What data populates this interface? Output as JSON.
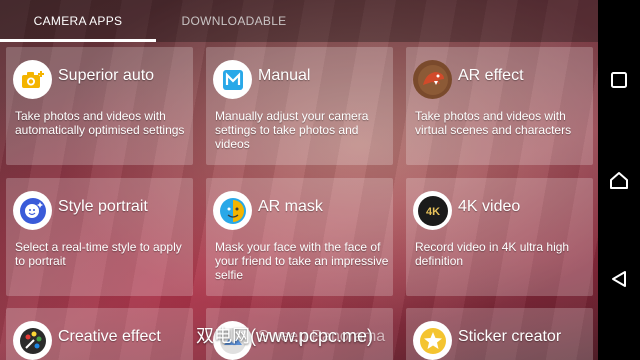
{
  "tabs": [
    {
      "label": "CAMERA APPS",
      "active": true
    },
    {
      "label": "DOWNLOADABLE",
      "active": false
    }
  ],
  "apps": [
    {
      "title": "Superior auto",
      "desc": "Take photos and videos with automatically optimised settings",
      "icon": "camera-plus-icon"
    },
    {
      "title": "Manual",
      "desc": "Manually adjust your camera settings to take photos and videos",
      "icon": "manual-m-icon"
    },
    {
      "title": "AR effect",
      "desc": "Take photos and videos with virtual scenes and characters",
      "icon": "dinosaur-icon"
    },
    {
      "title": "Style portrait",
      "desc": "Select a real-time style to apply to portrait",
      "icon": "face-sparkle-icon"
    },
    {
      "title": "AR mask",
      "desc": "Mask your face with the face of your friend to take an impressive selfie",
      "icon": "mask-face-icon"
    },
    {
      "title": "4K video",
      "desc": "Record video in 4K ultra high definition",
      "icon": "4k-badge-icon"
    },
    {
      "title": "Creative effect",
      "desc": "",
      "icon": "palette-icon"
    },
    {
      "title": "Sweep Panorama",
      "desc": "",
      "icon": "panorama-icon"
    },
    {
      "title": "Sticker creator",
      "desc": "",
      "icon": "star-sticker-icon"
    }
  ],
  "watermark": "双电网(www.pcpc.me)",
  "colors": {
    "accent_blue": "#2196F3",
    "tab_indicator": "#FFFFFF",
    "navbar": "#000000"
  }
}
